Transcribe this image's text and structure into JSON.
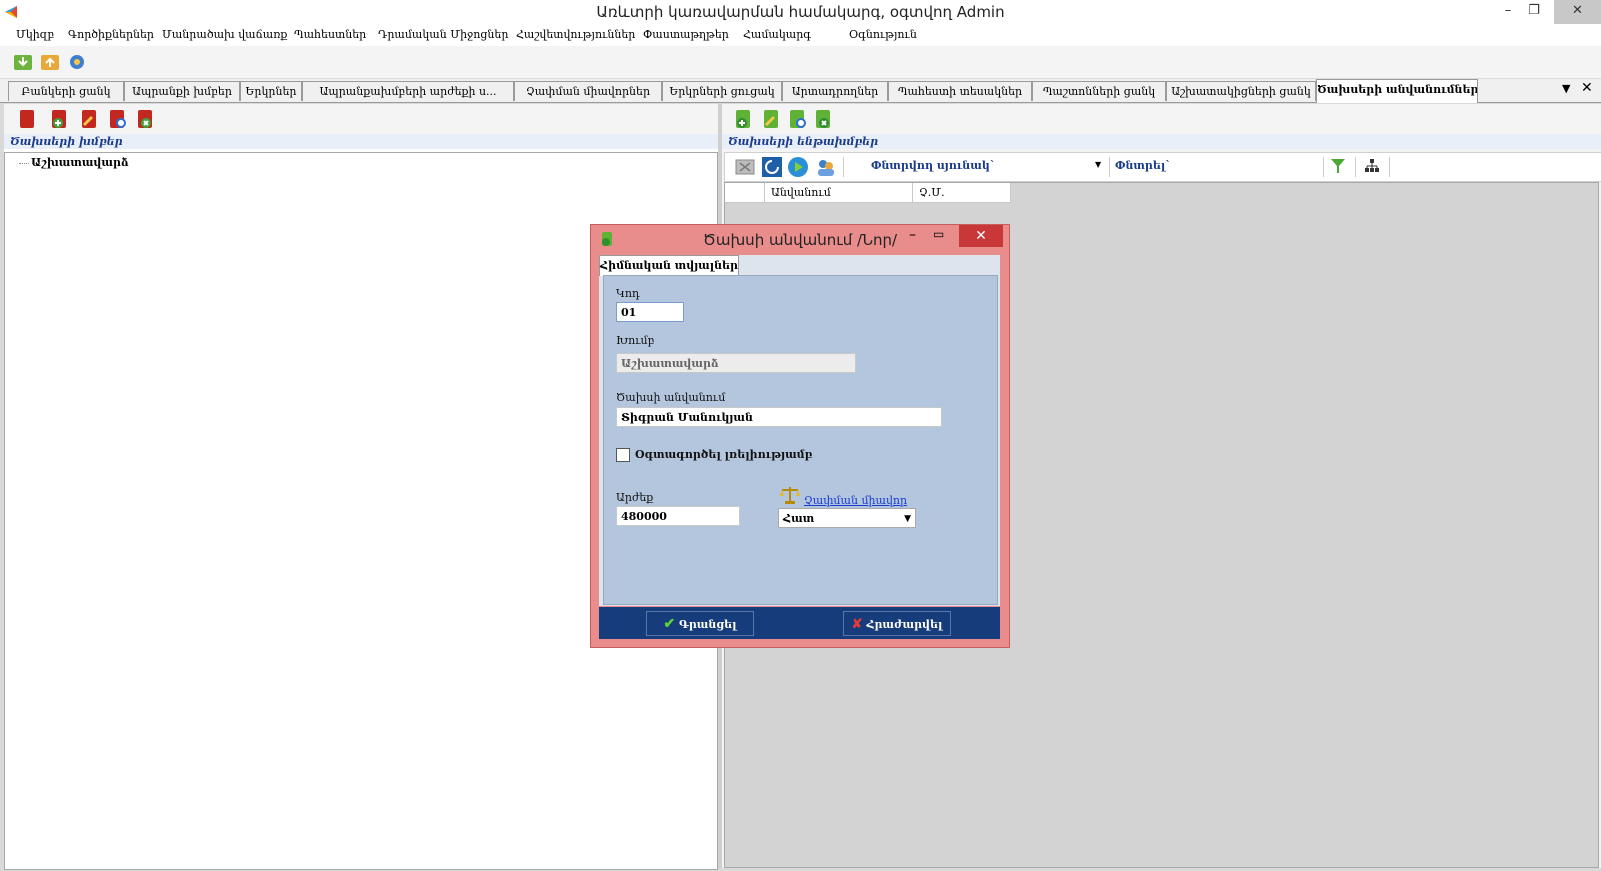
{
  "app": {
    "title": "Առևտրի կառավարման համակարգ, օգտվող Admin"
  },
  "menu": {
    "items": [
      "Մկիզբ",
      "Գործիքներներ",
      "Մանրածախ վաճառք",
      "Պահեստներ",
      "Դրամական Միջոցներ",
      "Հաշվետվություններ",
      "Փաստաթղթեր",
      "Համակարգ",
      "Օգնություն"
    ]
  },
  "tabs": [
    {
      "label": "Բանկերի ցանկ"
    },
    {
      "label": "Ապրանքի խմբեր"
    },
    {
      "label": "Երկրներ"
    },
    {
      "label": "Ապրանքախմբերի արժեքի ս..."
    },
    {
      "label": "Չափման միավորներ"
    },
    {
      "label": "Երկրների ցուցակ"
    },
    {
      "label": "Արտադրողներ"
    },
    {
      "label": "Պահեստի տեսակներ"
    },
    {
      "label": "Պաշտոնների ցանկ"
    },
    {
      "label": "Աշխատակիցների ցանկ"
    },
    {
      "label": "Ծախսերի անվանումներ"
    }
  ],
  "left_panel": {
    "header": "Ծախսերի խմբեր",
    "tree": [
      "Աշխատավարձ"
    ]
  },
  "right_panel": {
    "header": "Ծախսերի ենթախմբեր",
    "filter": {
      "column_label": "Փնտրվող սյունակ`",
      "search_label": "Փնտրել`"
    },
    "columns": [
      "Անվանում",
      "Չ.Մ."
    ]
  },
  "dialog": {
    "title": "Ծախսի անվանում /Նոր/",
    "tab": "Հիմնական տվյալներ",
    "code_label": "Կոդ",
    "code_value": "01",
    "group_label": "Խումբ",
    "group_value": "Աշխատավարձ",
    "name_label": "Ծախսի անվանում",
    "name_value": "Տիգրան Մանուկյան",
    "checkbox_label": "Օգտագործել լռելիությամբ",
    "checkbox_checked": false,
    "value_label": "Արժեք",
    "value_value": "480000",
    "unit_link": "Չափման միավոր",
    "unit_value": "Հատ",
    "save_label": "Գրանցել",
    "cancel_label": "Հրաժարվել"
  },
  "colors": {
    "dialog_frame": "#e98c8c",
    "dialog_content": "#b3c6de",
    "dialog_footer": "#173c7c",
    "header_text": "#1a3b8a"
  }
}
